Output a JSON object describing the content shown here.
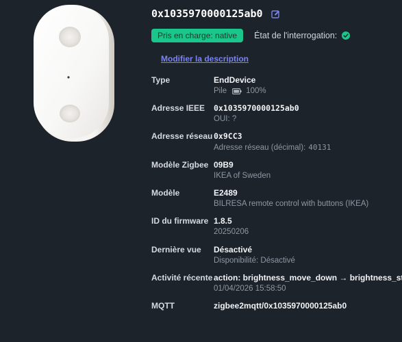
{
  "device": {
    "ieee_title": "0x1035970000125ab0",
    "edit_icon": "edit-icon",
    "support_badge": "Pris en charge: native",
    "poll_state_label": "État de l'interrogation:",
    "poll_state_icon": "check-circle-icon",
    "modify_description": "Modifier la description"
  },
  "colors": {
    "background": "#1d232a",
    "badge": "#1bc68a",
    "link": "#7b83f0",
    "check": "#1bc68a"
  },
  "info": {
    "type": {
      "label": "Type",
      "value": "EndDevice",
      "sub_prefix": "Pile",
      "battery_icon": "battery-icon",
      "battery_percent": "100%"
    },
    "ieee": {
      "label": "Adresse IEEE",
      "value": "0x1035970000125ab0",
      "sub": "OUI: ?"
    },
    "network": {
      "label": "Adresse réseau",
      "value": "0x9CC3",
      "sub_prefix": "Adresse réseau (décimal):",
      "sub_value": "40131"
    },
    "zigbee_model": {
      "label": "Modèle Zigbee",
      "value": "09B9",
      "sub": "IKEA of Sweden"
    },
    "model": {
      "label": "Modèle",
      "value": "E2489",
      "sub": "BILRESA remote control with buttons (IKEA)"
    },
    "firmware": {
      "label": "ID du firmware",
      "value": "1.8.5",
      "sub": "20250206"
    },
    "last_seen": {
      "label": "Dernière vue",
      "value": "Désactivé",
      "sub": "Disponibilité: Désactivé"
    },
    "recent_activity": {
      "label": "Activité récente",
      "value": "action: brightness_move_down → brightness_stop",
      "sub": "01/04/2026 15:58:50"
    },
    "mqtt": {
      "label": "MQTT",
      "value": "zigbee2mqtt/0x1035970000125ab0"
    }
  }
}
